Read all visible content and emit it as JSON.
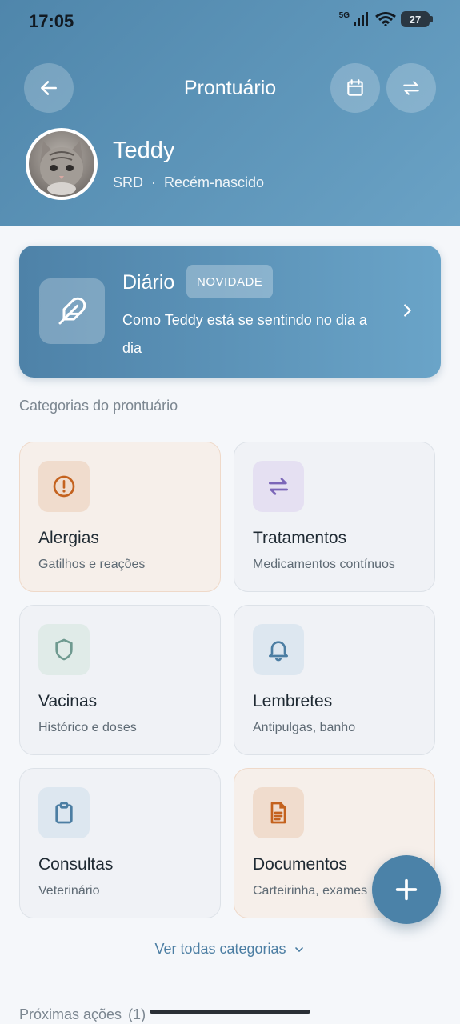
{
  "status_bar": {
    "time": "17:05",
    "network": "5G",
    "battery": "27"
  },
  "header": {
    "title": "Prontuário"
  },
  "pet": {
    "name": "Teddy",
    "breed": "SRD",
    "separator": "·",
    "age": "Recém-nascido"
  },
  "diary": {
    "title": "Diário",
    "badge": "NOVIDADE",
    "description": "Como Teddy está se sentindo no dia a dia"
  },
  "categories_section": {
    "label": "Categorias do prontuário"
  },
  "categories": [
    {
      "title": "Alergias",
      "subtitle": "Gatilhos e reações",
      "icon": "alert-circle-icon",
      "color": "#c4621e"
    },
    {
      "title": "Tratamentos",
      "subtitle": "Medicamentos contínuos",
      "icon": "swap-icon",
      "color": "#7b66b8"
    },
    {
      "title": "Vacinas",
      "subtitle": "Histórico e doses",
      "icon": "shield-icon",
      "color": "#6f9a90"
    },
    {
      "title": "Lembretes",
      "subtitle": "Antipulgas, banho",
      "icon": "bell-icon",
      "color": "#4c7ea3"
    },
    {
      "title": "Consultas",
      "subtitle": "Veterinário",
      "icon": "clipboard-icon",
      "color": "#4c7ea3"
    },
    {
      "title": "Documentos",
      "subtitle": "Carteirinha, exames",
      "icon": "document-icon",
      "color": "#c4621e"
    }
  ],
  "see_all": {
    "label": "Ver todas categorias"
  },
  "next_actions": {
    "label": "Próximas ações",
    "count": "(1)"
  },
  "colors": {
    "header_start": "#4f86ab",
    "header_end": "#6aa2c5",
    "accent": "#4b82a8"
  }
}
